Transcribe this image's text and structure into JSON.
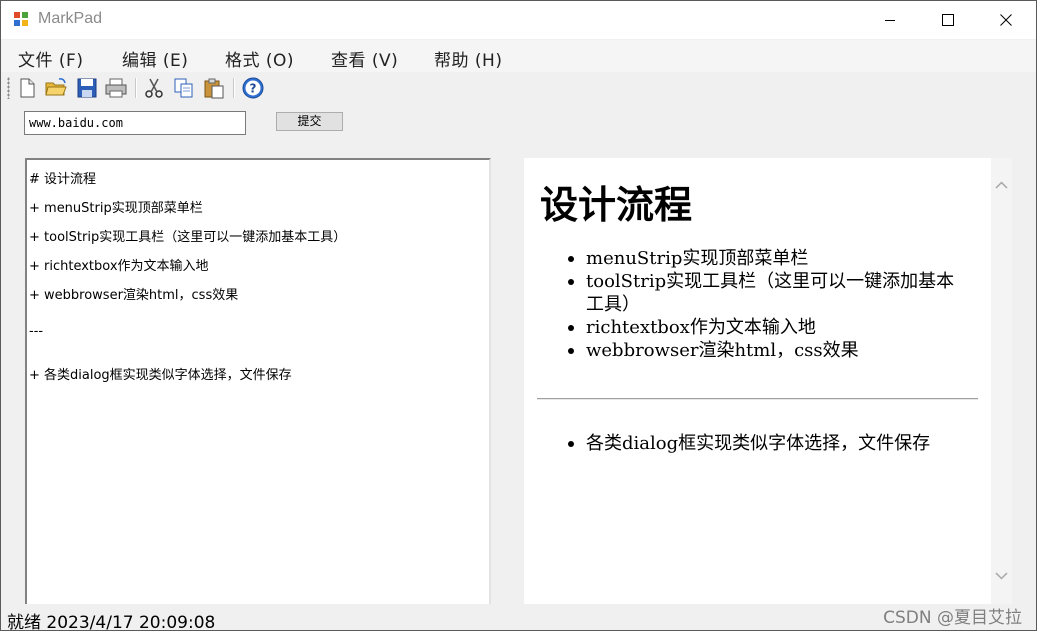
{
  "window": {
    "title": "MarkPad"
  },
  "menu": [
    {
      "label": "文件 (F)"
    },
    {
      "label": "编辑 (E)"
    },
    {
      "label": "格式 (O)"
    },
    {
      "label": "查看 (V)"
    },
    {
      "label": "帮助 (H)"
    }
  ],
  "toolbar": {
    "icons": [
      "new-file-icon",
      "open-folder-icon",
      "save-icon",
      "print-icon",
      "cut-icon",
      "copy-icon",
      "paste-icon",
      "help-icon"
    ]
  },
  "url_bar": {
    "value": "www.baidu.com",
    "submit_label": "提交"
  },
  "editor": {
    "lines": [
      "# 设计流程",
      "+ menuStrip实现顶部菜单栏",
      "+ toolStrip实现工具栏（这里可以一键添加基本工具）",
      "+ richtextbox作为文本输入地",
      "+ webbrowser渲染html，css效果",
      "---",
      "+ 各类dialog框实现类似字体选择，文件保存"
    ]
  },
  "preview": {
    "heading": "设计流程",
    "list1": [
      "menuStrip实现顶部菜单栏",
      "toolStrip实现工具栏（这里可以一键添加基本工具）",
      "richtextbox作为文本输入地",
      "webbrowser渲染html，css效果"
    ],
    "list2": [
      "各类dialog框实现类似字体选择，文件保存"
    ]
  },
  "status": {
    "text": "就绪  2023/4/17 20:09:08"
  },
  "watermark": "CSDN @夏目艾拉"
}
